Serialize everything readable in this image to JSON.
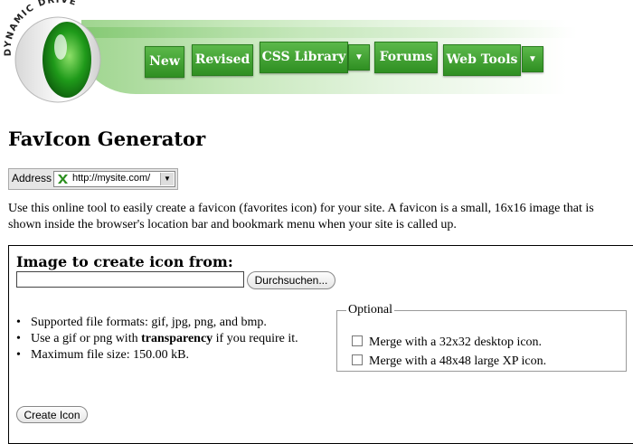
{
  "header": {
    "logo_text": "DYNAMIC DRIVE",
    "nav": [
      {
        "label": "New",
        "has_dropdown": false
      },
      {
        "label": "Revised",
        "has_dropdown": false
      },
      {
        "label": "CSS Library",
        "has_dropdown": true
      },
      {
        "label": "Forums",
        "has_dropdown": false
      },
      {
        "label": "Web Tools",
        "has_dropdown": true
      }
    ],
    "dropdown_icon": "triangle-down-icon"
  },
  "page_title": "FavIcon Generator",
  "address_bar": {
    "label": "Address",
    "url": "http://mysite.com/",
    "icon": "favicon-icon"
  },
  "intro": "Use this online tool to easily create a favicon (favorites icon) for your site. A favicon is a small, 16x16 image that is shown inside the browser's location bar and bookmark menu when your site is called up.",
  "form": {
    "title": "Image to create icon from:",
    "file_value": "",
    "browse_label": "Durchsuchen...",
    "notes": [
      {
        "text": "Supported file formats: gif, jpg, png, and bmp."
      },
      {
        "pre": "Use a gif or png with ",
        "bold": "transparency",
        "post": " if you require it."
      },
      {
        "text": "Maximum file size: 150.00 kB."
      }
    ],
    "optional": {
      "legend": "Optional",
      "options": [
        {
          "label": "Merge with a 32x32 desktop icon.",
          "checked": false
        },
        {
          "label": "Merge with a 48x48 large XP icon.",
          "checked": false
        }
      ]
    },
    "create_label": "Create Icon"
  }
}
